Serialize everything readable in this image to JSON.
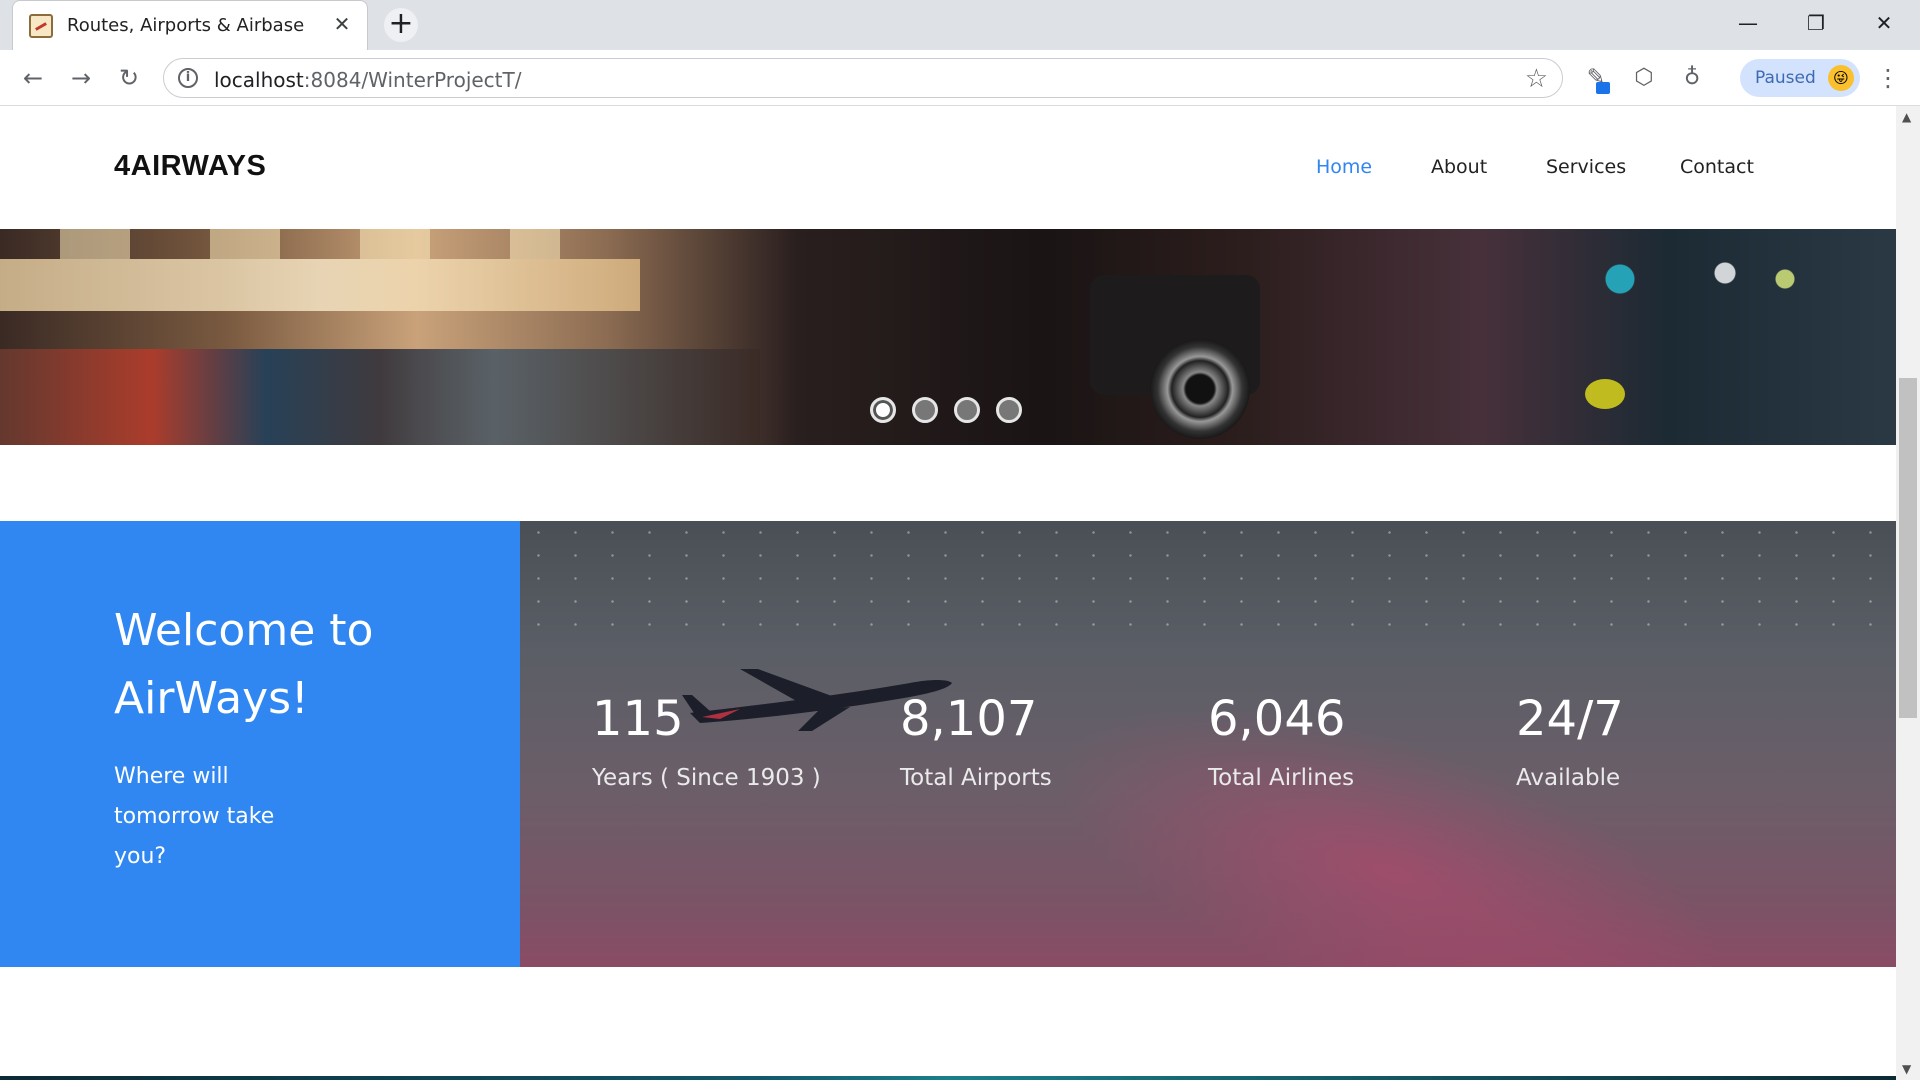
{
  "browser": {
    "tab_title": "Routes, Airports & Airbase",
    "tab_close": "✕",
    "new_tab": "+",
    "window_controls": {
      "minimize": "—",
      "restore": "❐",
      "close": "✕"
    },
    "nav": {
      "back": "←",
      "forward": "→",
      "reload": "↻"
    },
    "url_host": "localhost",
    "url_path": ":8084/WinterProjectT/",
    "bookmark_icon": "☆",
    "extensions": [
      "pen-icon",
      "shield-icon",
      "lightbulb-icon"
    ],
    "profile_status": "Paused",
    "profile_avatar": "😜",
    "menu_icon": "⋮"
  },
  "site": {
    "brand": "4AIRWAYS",
    "nav_links": [
      {
        "label": "Home",
        "active": true
      },
      {
        "label": "About",
        "active": false
      },
      {
        "label": "Services",
        "active": false
      },
      {
        "label": "Contact",
        "active": false
      }
    ],
    "carousel": {
      "slide_count": 4,
      "active_index": 0
    },
    "welcome": {
      "title": "Welcome to AirWays!",
      "subtitle": "Where will tomorrow take you?"
    },
    "stats": [
      {
        "value": "115",
        "label": "Years ( Since 1903 )"
      },
      {
        "value": "8,107",
        "label": "Total Airports"
      },
      {
        "value": "6,046",
        "label": "Total Airlines"
      },
      {
        "value": "24/7",
        "label": "Available"
      }
    ]
  },
  "colors": {
    "accent": "#3087f2",
    "active_nav": "#3085f0",
    "brand_text": "#111111"
  }
}
